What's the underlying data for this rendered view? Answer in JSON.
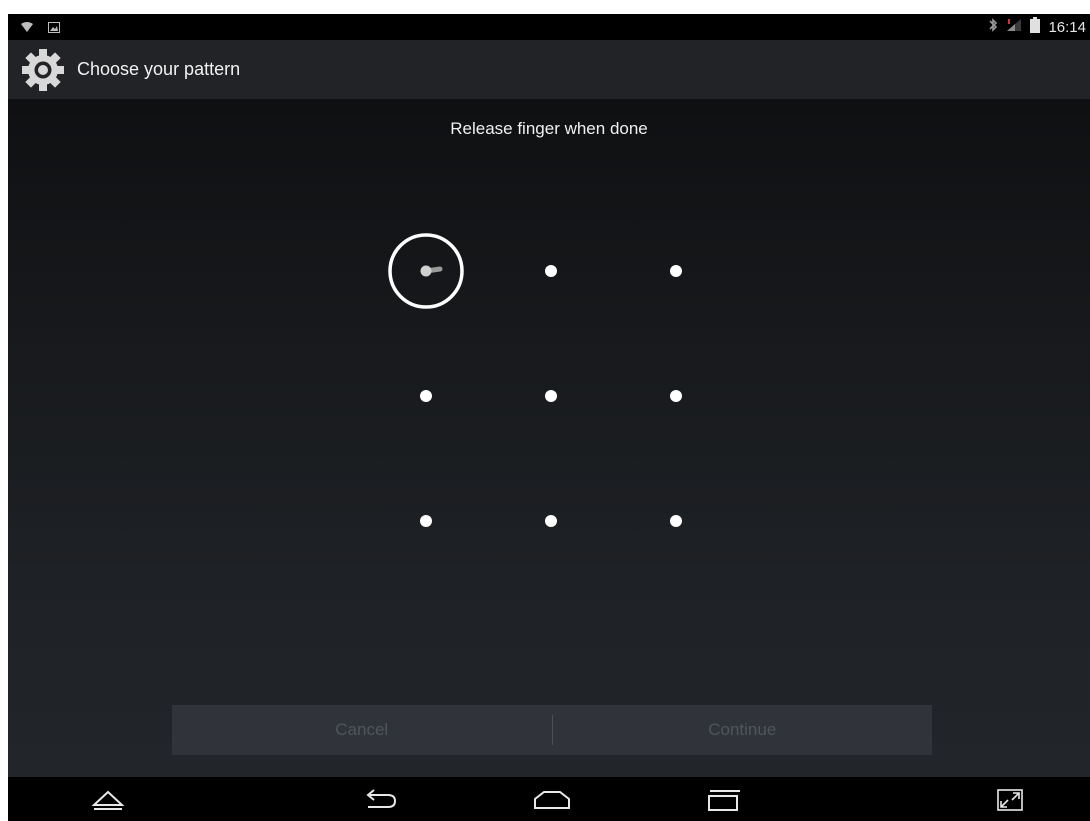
{
  "status_bar": {
    "time": "16:14",
    "left_icons": [
      "wifi-icon",
      "image-notification-icon"
    ],
    "right_icons": [
      "bluetooth-icon",
      "signal-icon",
      "battery-icon"
    ]
  },
  "action_bar": {
    "title": "Choose your pattern",
    "icon": "settings-gear-icon"
  },
  "pattern": {
    "header": "Release finger when done",
    "grid": "3x3",
    "selected_dots": [
      1
    ]
  },
  "buttons": {
    "cancel_label": "Cancel",
    "continue_label": "Continue"
  },
  "nav_bar": {
    "icons": [
      "hide-keyboard-icon",
      "back-icon",
      "home-icon",
      "recent-apps-icon",
      "fullscreen-icon"
    ]
  },
  "colors": {
    "action_bar_bg": "#222326",
    "content_top": "#0f1012",
    "content_bottom": "#22262a",
    "dot": "#ffffff",
    "button_bar_bg": "#30343a",
    "button_text_disabled": "#4f555c"
  }
}
